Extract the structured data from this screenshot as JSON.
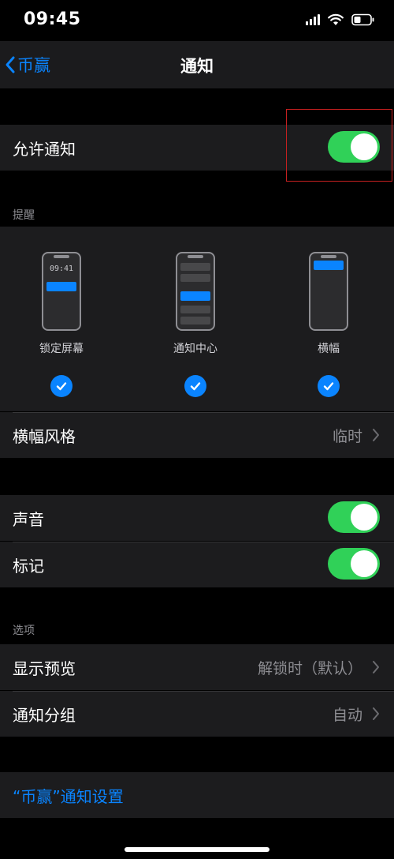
{
  "status": {
    "time": "09:45"
  },
  "nav": {
    "back_label": "币赢",
    "title": "通知"
  },
  "allow_notifications": {
    "label": "允许通知",
    "enabled": true
  },
  "alerts": {
    "header": "提醒",
    "options": [
      {
        "label": "锁定屏幕",
        "checked": true,
        "preview_time": "09:41"
      },
      {
        "label": "通知中心",
        "checked": true
      },
      {
        "label": "横幅",
        "checked": true
      }
    ],
    "banner_style": {
      "label": "横幅风格",
      "value": "临时"
    }
  },
  "sounds": {
    "label": "声音",
    "enabled": true
  },
  "badges": {
    "label": "标记",
    "enabled": true
  },
  "options": {
    "header": "选项",
    "show_previews": {
      "label": "显示预览",
      "value": "解锁时（默认）"
    },
    "grouping": {
      "label": "通知分组",
      "value": "自动"
    }
  },
  "app_settings_link": "“币赢”通知设置",
  "colors": {
    "accent": "#0a84ff",
    "toggle_on": "#30d158",
    "highlight": "#c62020",
    "cell_bg": "#1c1c1e"
  }
}
